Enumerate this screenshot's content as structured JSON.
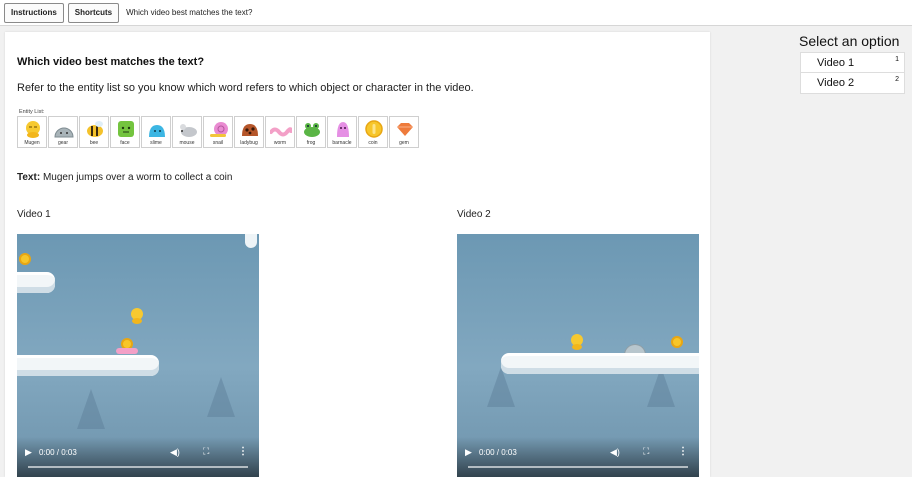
{
  "topbar": {
    "instructions_label": "Instructions",
    "shortcuts_label": "Shortcuts",
    "title": "Which video best matches the text?"
  },
  "main": {
    "heading": "Which video best matches the text?",
    "instruction": "Refer to the entity list so you know which word refers to which object or character in the video.",
    "entity_list_label": "Entity List:",
    "entities": [
      {
        "name": "Mugen",
        "icon": "mugen-icon",
        "color": "#f7c930"
      },
      {
        "name": "gear",
        "icon": "gear-icon",
        "color": "#a9b4b9"
      },
      {
        "name": "bee",
        "icon": "bee-icon",
        "color": "#f4c22b"
      },
      {
        "name": "face",
        "icon": "face-icon",
        "color": "#74c43f"
      },
      {
        "name": "slime",
        "icon": "slime-icon",
        "color": "#3cb6e3"
      },
      {
        "name": "mouse",
        "icon": "mouse-icon",
        "color": "#c4c7cc"
      },
      {
        "name": "snail",
        "icon": "snail-icon",
        "color": "#e98bd1"
      },
      {
        "name": "ladybug",
        "icon": "ladybug-icon",
        "color": "#b5562a"
      },
      {
        "name": "worm",
        "icon": "worm-icon",
        "color": "#f3a0c7"
      },
      {
        "name": "frog",
        "icon": "frog-icon",
        "color": "#5ab545"
      },
      {
        "name": "barnacle",
        "icon": "barnacle-icon",
        "color": "#e58fe4"
      },
      {
        "name": "coin",
        "icon": "coin-icon",
        "color": "#f7c62a"
      },
      {
        "name": "gem",
        "icon": "gem-icon",
        "color": "#ee7b3c"
      }
    ],
    "text_label": "Text:",
    "text_value": "Mugen jumps over a worm to collect a coin",
    "videos": [
      {
        "label": "Video 1",
        "time": "0:00 / 0:03"
      },
      {
        "label": "Video 2",
        "time": "0:00 / 0:03"
      }
    ]
  },
  "sidebar": {
    "title": "Select an option",
    "options": [
      {
        "label": "Video 1",
        "shortcut": "1"
      },
      {
        "label": "Video 2",
        "shortcut": "2"
      }
    ]
  }
}
